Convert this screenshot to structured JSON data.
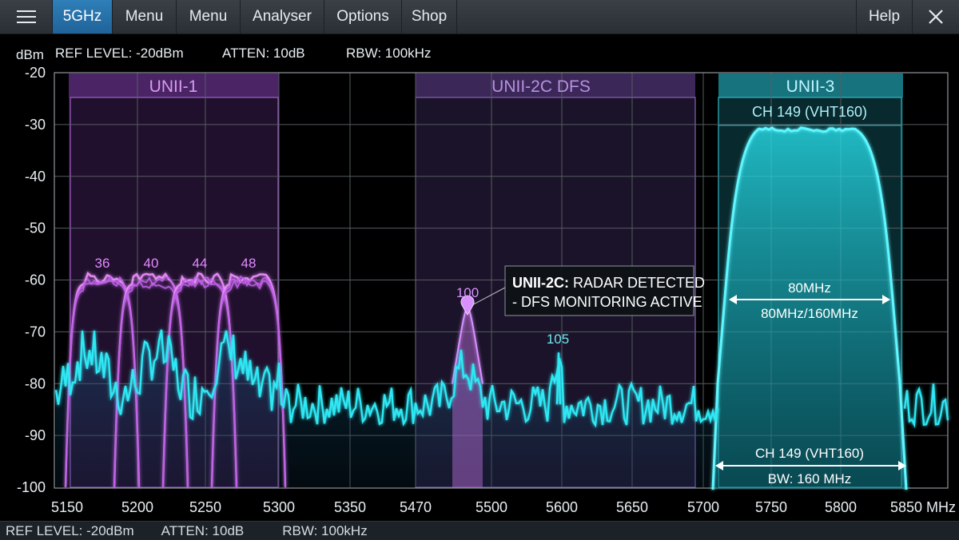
{
  "menubar": {
    "items": [
      {
        "label": "5GHz",
        "active": true
      },
      {
        "label": "Menu",
        "active": false
      },
      {
        "label": "Menu",
        "active": false
      },
      {
        "label": "Analyser",
        "active": false
      },
      {
        "label": "Options",
        "active": false
      },
      {
        "label": "Shop",
        "active": false
      }
    ],
    "help_label": "Help",
    "menu_icon": "hamburger-icon",
    "close_icon": "close-icon"
  },
  "info": {
    "unit": "dBm",
    "ref_level": "REF LEVEL: -20dBm",
    "atten": "ATTEN: 10dB",
    "rbw": "RBW: 100kHz"
  },
  "footer": {
    "ref_level": "REF LEVEL: -20dBm",
    "atten": "ATTEN: 10dB",
    "rbw": "RBW: 100kHz"
  },
  "colors": {
    "unii1": "#e070ff",
    "unii2c": "#b070d0",
    "trace": "#22e6f0",
    "unii3": "#20c8d8",
    "grid": "#555c60"
  },
  "chart_data": {
    "type": "line",
    "ylim": [
      -100,
      -20
    ],
    "yticks": [
      "-20",
      "-30",
      "-40",
      "-50",
      "-60",
      "-70",
      "-80",
      "-90",
      "-100"
    ],
    "xticks": [
      "5150",
      "5200",
      "5250",
      "5300",
      "5350",
      "5470",
      "5500",
      "5600",
      "5650",
      "5700",
      "5750",
      "5800",
      "5850 MHz"
    ],
    "bands": [
      {
        "label": "UNII-1",
        "from": "5150",
        "to": "5300"
      },
      {
        "label": "UNII-2C DFS",
        "from": "5470",
        "to": "5700"
      },
      {
        "label": "UNII-3",
        "from": "5710",
        "to": "5850"
      }
    ],
    "channels": [
      {
        "label": "36",
        "peak_dbm": -59
      },
      {
        "label": "40",
        "peak_dbm": -59
      },
      {
        "label": "44",
        "peak_dbm": -59
      },
      {
        "label": "48",
        "peak_dbm": -59
      }
    ],
    "radar": {
      "label": "100",
      "peak_dbm": -65
    },
    "spur": {
      "label": "105",
      "peak_dbm": -74
    },
    "callout_bold": "UNII-2C:",
    "callout_rest": " RADAR DETECTED",
    "callout_line2": "- DFS MONITORING ACTIVE",
    "unii3_channel": "CH 149 (VHT160)",
    "unii3_plateau_dbm": -31,
    "bw_label_1": "80MHz",
    "bw_label_2": "80MHz/160MHz",
    "bottom_channel": "CH 149 (VHT160)",
    "bottom_bw": "BW: 160 MHz",
    "noise_floor_dbm": -84
  }
}
